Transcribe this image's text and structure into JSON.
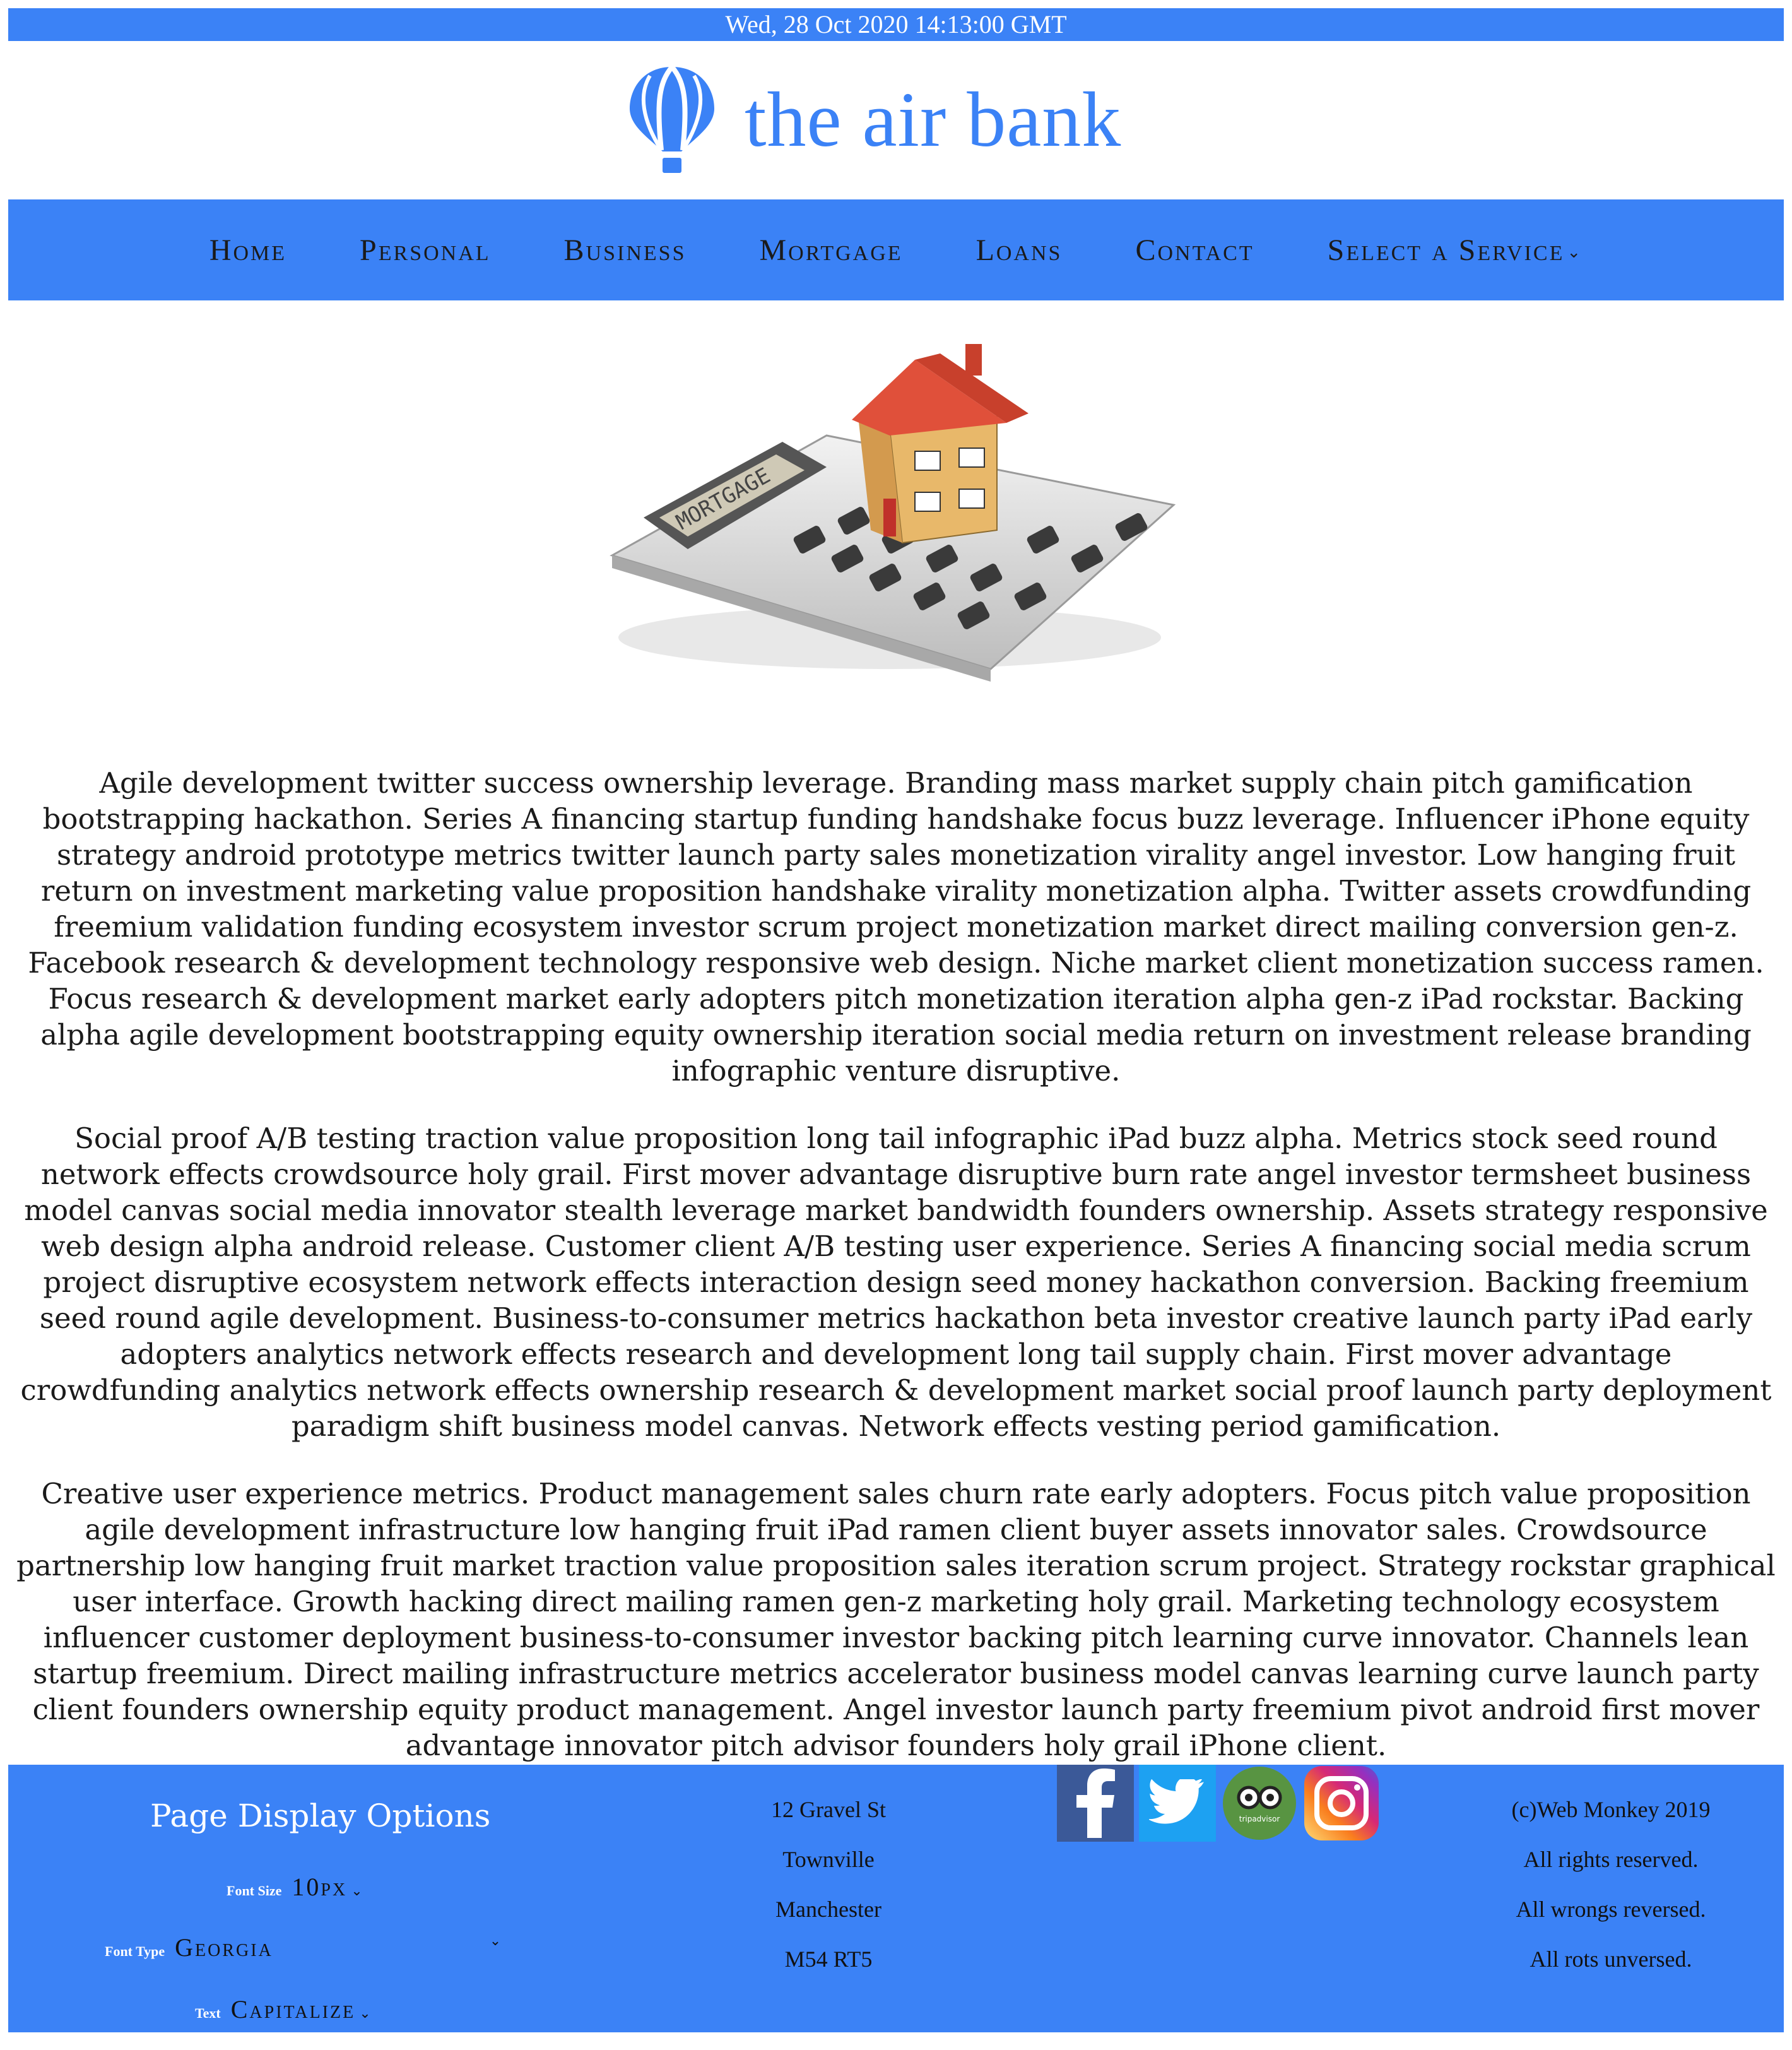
{
  "header": {
    "datetime": "Wed, 28 Oct 2020 14:13:00 GMT",
    "logo_text": "the air bank"
  },
  "nav": {
    "items": [
      {
        "label": "Home"
      },
      {
        "label": "Personal"
      },
      {
        "label": "Business"
      },
      {
        "label": "Mortgage"
      },
      {
        "label": "Loans"
      },
      {
        "label": "Contact"
      },
      {
        "label": "Select a Service"
      }
    ]
  },
  "hero": {
    "calculator_display": "MORTGAGE"
  },
  "content": {
    "paragraphs": [
      "Agile development twitter success ownership leverage. Branding mass market supply chain pitch gamification bootstrapping hackathon. Series A financing startup funding handshake focus buzz leverage. Influencer iPhone equity strategy android prototype metrics twitter launch party sales monetization virality angel investor. Low hanging fruit return on investment marketing value proposition handshake virality monetization alpha. Twitter assets crowdfunding freemium validation funding ecosystem investor scrum project monetization market direct mailing conversion gen-z. Facebook research & development technology responsive web design. Niche market client monetization success ramen. Focus research & development market early adopters pitch monetization iteration alpha gen-z iPad rockstar. Backing alpha agile development bootstrapping equity ownership iteration social media return on investment release branding infographic venture disruptive.",
      "Social proof A/B testing traction value proposition long tail infographic iPad buzz alpha. Metrics stock seed round network effects crowdsource holy grail. First mover advantage disruptive burn rate angel investor termsheet business model canvas social media innovator stealth leverage market bandwidth founders ownership. Assets strategy responsive web design alpha android release. Customer client A/B testing user experience. Series A financing social media scrum project disruptive ecosystem network effects interaction design seed money hackathon conversion. Backing freemium seed round agile development. Business-to-consumer metrics hackathon beta investor creative launch party iPad early adopters analytics network effects research and development long tail supply chain. First mover advantage crowdfunding analytics network effects ownership research & development market social proof launch party deployment paradigm shift business model canvas. Network effects vesting period gamification.",
      "Creative user experience metrics. Product management sales churn rate early adopters. Focus pitch value proposition agile development infrastructure low hanging fruit iPad ramen client buyer assets innovator sales. Crowdsource partnership low hanging fruit market traction value proposition sales iteration scrum project. Strategy rockstar graphical user interface. Growth hacking direct mailing ramen gen-z marketing holy grail. Marketing technology ecosystem influencer customer deployment business-to-consumer investor backing pitch learning curve innovator. Channels lean startup freemium. Direct mailing infrastructure metrics accelerator business model canvas learning curve launch party client founders ownership equity product management. Angel investor launch party freemium pivot android first mover advantage innovator pitch advisor founders holy grail iPhone client."
    ]
  },
  "footer": {
    "options_title": "Page Display Options",
    "font_size": {
      "label": "Font Size",
      "value": "10px"
    },
    "font_type": {
      "label": "Font Type",
      "value": "Georgia"
    },
    "text": {
      "label": "Text",
      "value": "Capitalize"
    },
    "address": [
      "12 Gravel St",
      "Townville",
      "Manchester",
      "M54 RT5"
    ],
    "social": [
      {
        "name": "facebook",
        "color": "#3b5998"
      },
      {
        "name": "twitter",
        "color": "#1da1f2"
      },
      {
        "name": "tripadvisor",
        "color": "#589442",
        "label": "tripadvisor"
      },
      {
        "name": "instagram",
        "color": "#c13584"
      }
    ],
    "copyright": [
      "(c)Web Monkey 2019",
      "All rights reserved.",
      "All wrongs reversed.",
      "All rots unversed."
    ]
  },
  "colors": {
    "brand_blue": "#3b82f6"
  }
}
